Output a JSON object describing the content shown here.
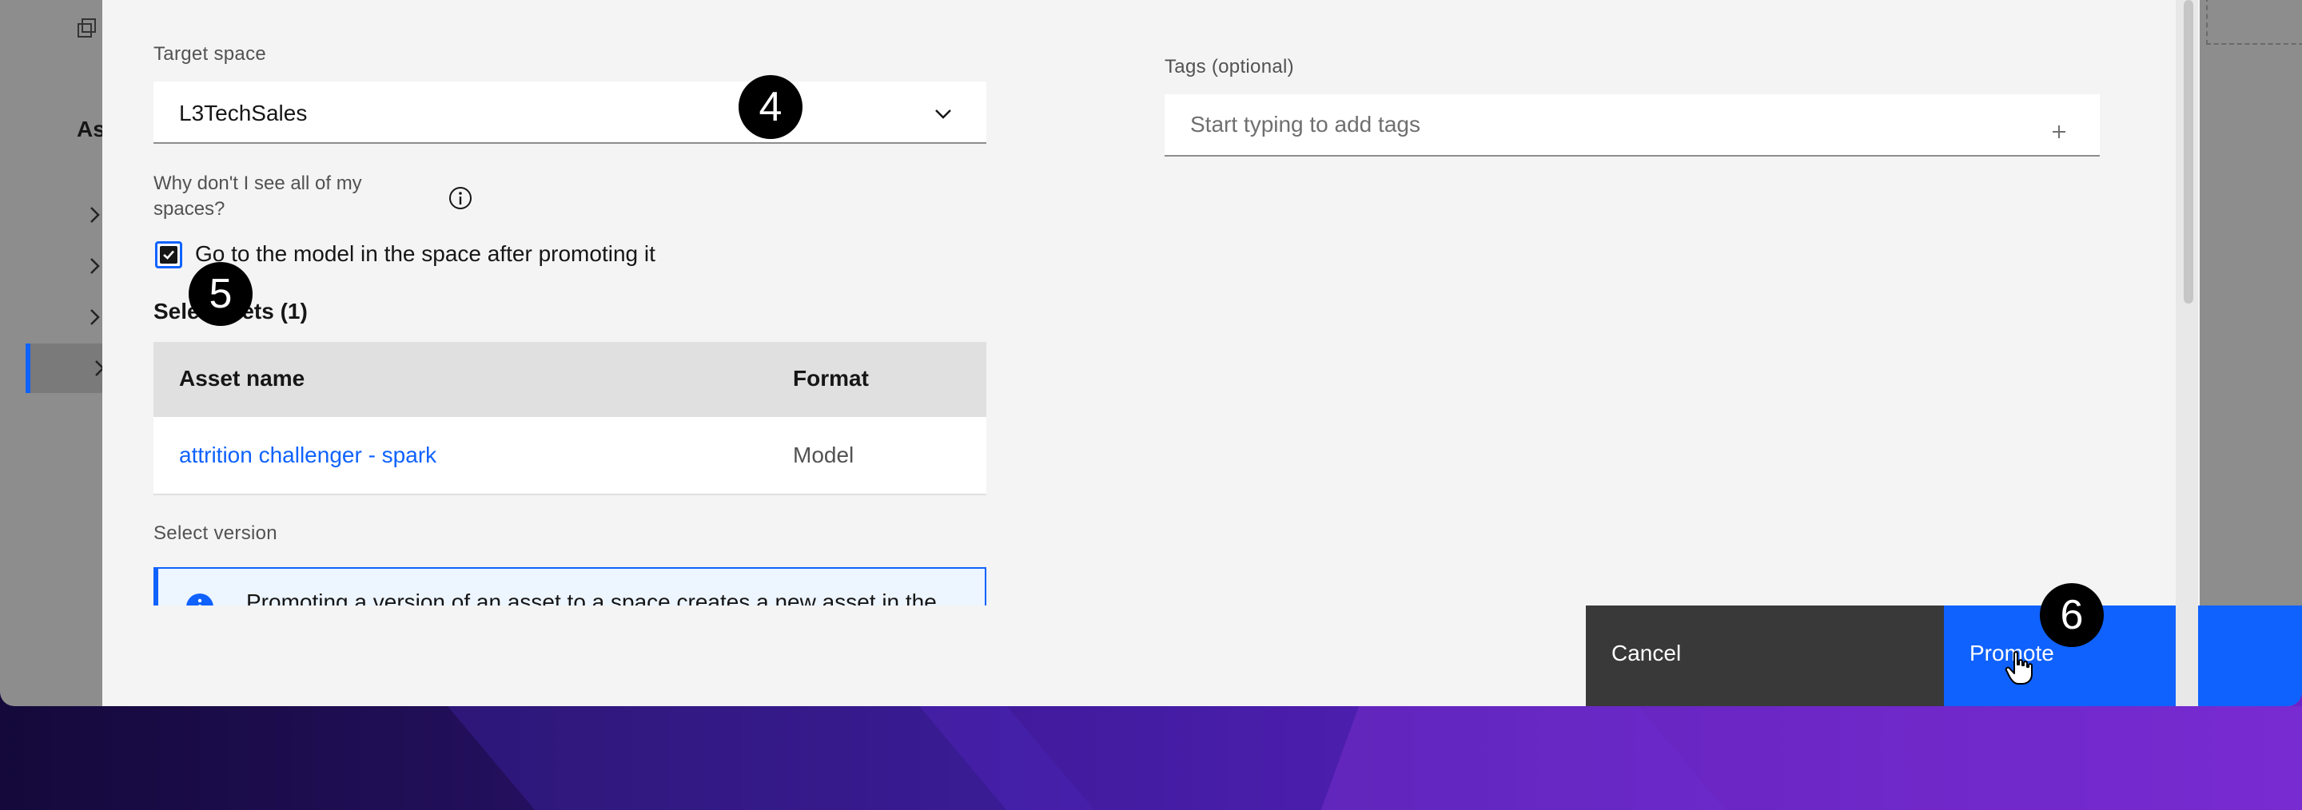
{
  "colors": {
    "primary": "#0f62fe",
    "cancel_button": "#393939",
    "modal_background": "#f4f4f4",
    "table_header": "#e0e0e0",
    "badge": "#000000"
  },
  "background_page": {
    "section_title": "As",
    "icons": [
      "copy-icon",
      "chevron-right-icon"
    ]
  },
  "modal": {
    "target_space": {
      "label": "Target space",
      "value": "L3TechSales"
    },
    "why_text": "Why don't I see all of my spaces?",
    "checkbox": {
      "label": "Go to the model in the space after promoting it",
      "checked": true
    },
    "selected_assets": {
      "title": "Selected assets (1)",
      "title_visible_fragment": "assets (1)",
      "title_hidden_prefix": "Sele",
      "columns": [
        "Asset name",
        "Format"
      ],
      "rows": [
        {
          "name": "attrition challenger - spark",
          "format": "Model"
        }
      ]
    },
    "select_version_label": "Select version",
    "notification_text": "Promoting a version of an asset to a space creates a new asset in the",
    "tags": {
      "label": "Tags (optional)",
      "placeholder": "Start typing to add tags"
    },
    "buttons": {
      "cancel": "Cancel",
      "promote": "Promote"
    }
  },
  "badges": {
    "step4": "4",
    "step5": "5",
    "step6": "6"
  }
}
